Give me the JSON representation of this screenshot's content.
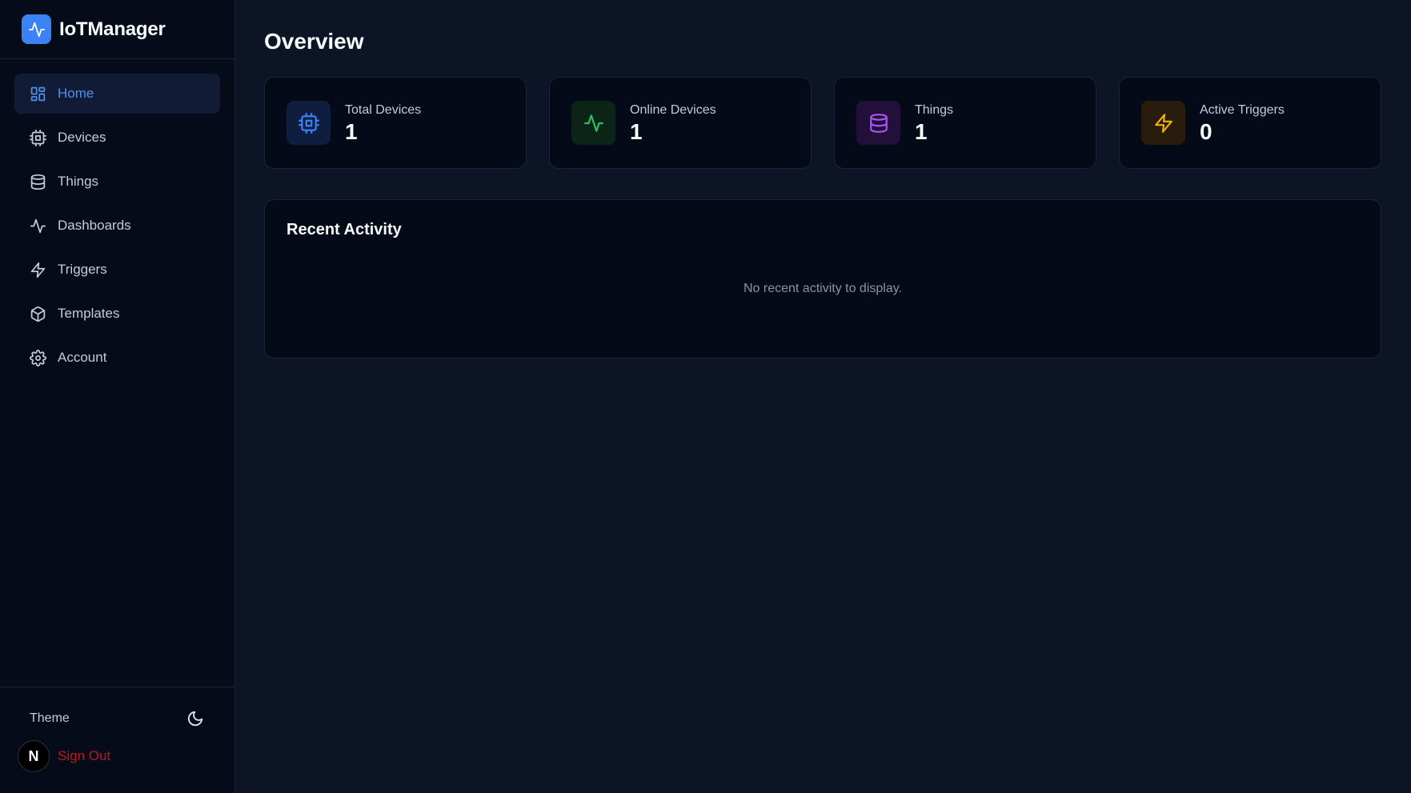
{
  "app": {
    "name": "IoTManager"
  },
  "sidebar": {
    "items": [
      {
        "label": "Home",
        "icon": "grid-icon",
        "active": true
      },
      {
        "label": "Devices",
        "icon": "cpu-icon"
      },
      {
        "label": "Things",
        "icon": "database-icon"
      },
      {
        "label": "Dashboards",
        "icon": "activity-icon"
      },
      {
        "label": "Triggers",
        "icon": "zap-icon"
      },
      {
        "label": "Templates",
        "icon": "box-icon"
      },
      {
        "label": "Account",
        "icon": "gear-icon"
      }
    ],
    "theme_label": "Theme",
    "avatar_initial": "N",
    "signout_label": "Sign Out"
  },
  "main": {
    "title": "Overview",
    "stats": [
      {
        "label": "Total Devices",
        "value": "1",
        "icon": "cpu-icon",
        "color": "#3b82f6"
      },
      {
        "label": "Online Devices",
        "value": "1",
        "icon": "activity-icon",
        "color": "#22c55e"
      },
      {
        "label": "Things",
        "value": "1",
        "icon": "database-icon",
        "color": "#a855f7"
      },
      {
        "label": "Active Triggers",
        "value": "0",
        "icon": "zap-icon",
        "color": "#eab308"
      }
    ],
    "activity": {
      "title": "Recent Activity",
      "empty_text": "No recent activity to display."
    }
  },
  "colors": {
    "accent": "#3b82f6",
    "danger": "#b91c1c"
  }
}
